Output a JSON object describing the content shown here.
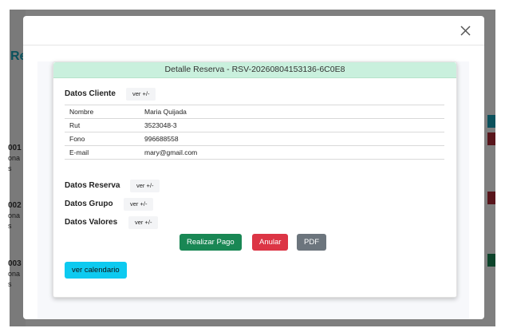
{
  "background": {
    "title_fragment": "Re",
    "rows": [
      {
        "code": "001",
        "line2": "ona",
        "line3": "s"
      },
      {
        "code": "002",
        "line2": "ona",
        "line3": "s"
      },
      {
        "code": "003",
        "line2": "ona",
        "line3": "s"
      }
    ]
  },
  "modal": {
    "close_symbol": "×",
    "card_title": "Detalle Reserva - RSV-20260804153136-6C0E8",
    "cliente": {
      "title": "Datos Cliente",
      "toggle": "ver +/-",
      "rows": [
        {
          "label": "Nombre",
          "value": "Maria Quijada"
        },
        {
          "label": "Rut",
          "value": "3523048-3"
        },
        {
          "label": "Fono",
          "value": "996688558"
        },
        {
          "label": "E-mail",
          "value": "mary@gmail.com"
        }
      ]
    },
    "reserva": {
      "title": "Datos Reserva",
      "toggle": "ver +/-"
    },
    "grupo": {
      "title": "Datos Grupo",
      "toggle": "ver +/-"
    },
    "valores": {
      "title": "Datos Valores",
      "toggle": "ver +/-"
    },
    "buttons": {
      "pay": "Realizar Pago",
      "cancel": "Anular",
      "pdf": "PDF",
      "calendar": "ver calendario"
    }
  },
  "colors": {
    "success": "#198754",
    "danger": "#dc3545",
    "secondary": "#6c757d",
    "info": "#0dcaf0",
    "header_green": "#c9f0dd",
    "title_teal": "#17a2b8"
  }
}
